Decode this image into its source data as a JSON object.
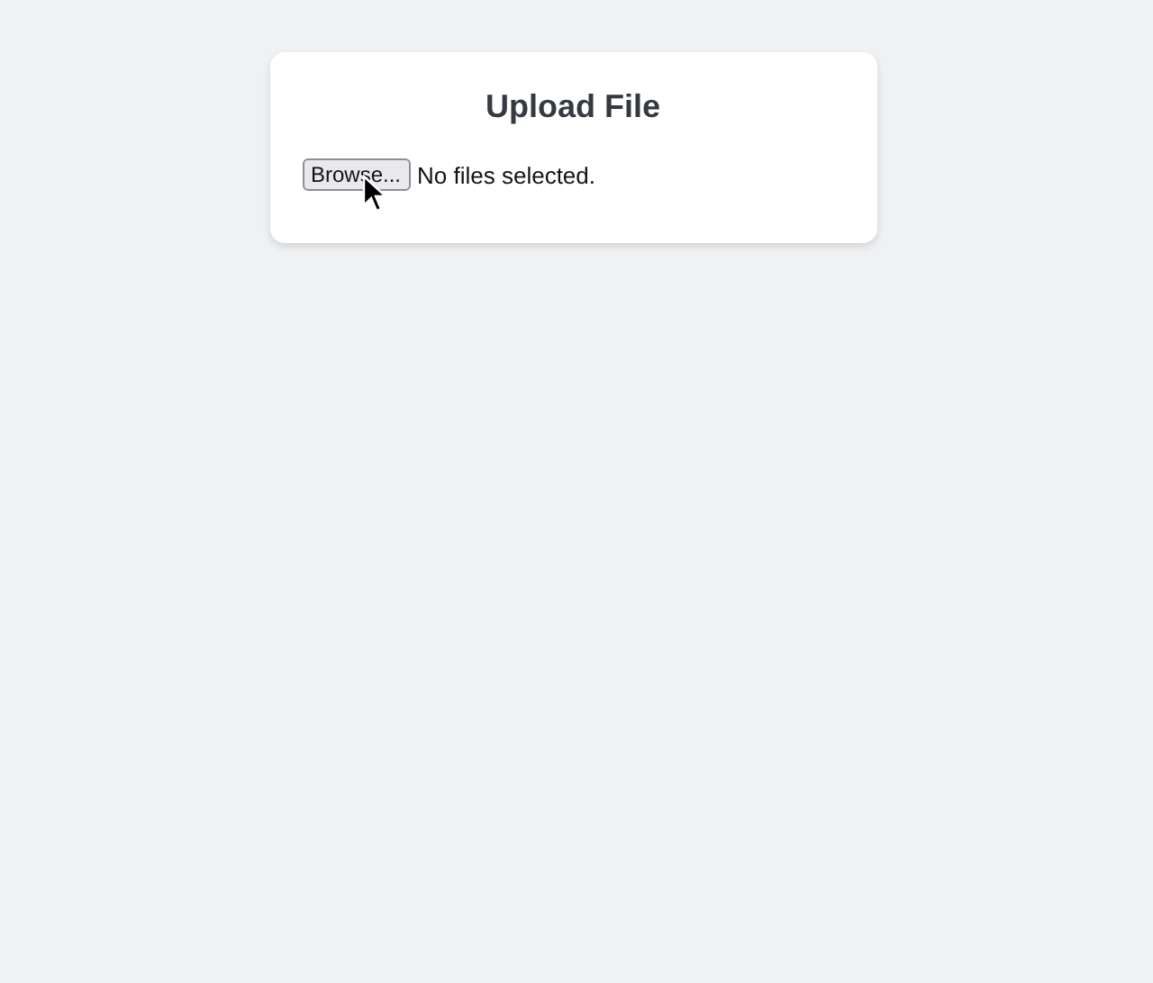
{
  "card": {
    "title": "Upload File",
    "file_input": {
      "button_label": "Browse...",
      "status": "No files selected."
    }
  }
}
